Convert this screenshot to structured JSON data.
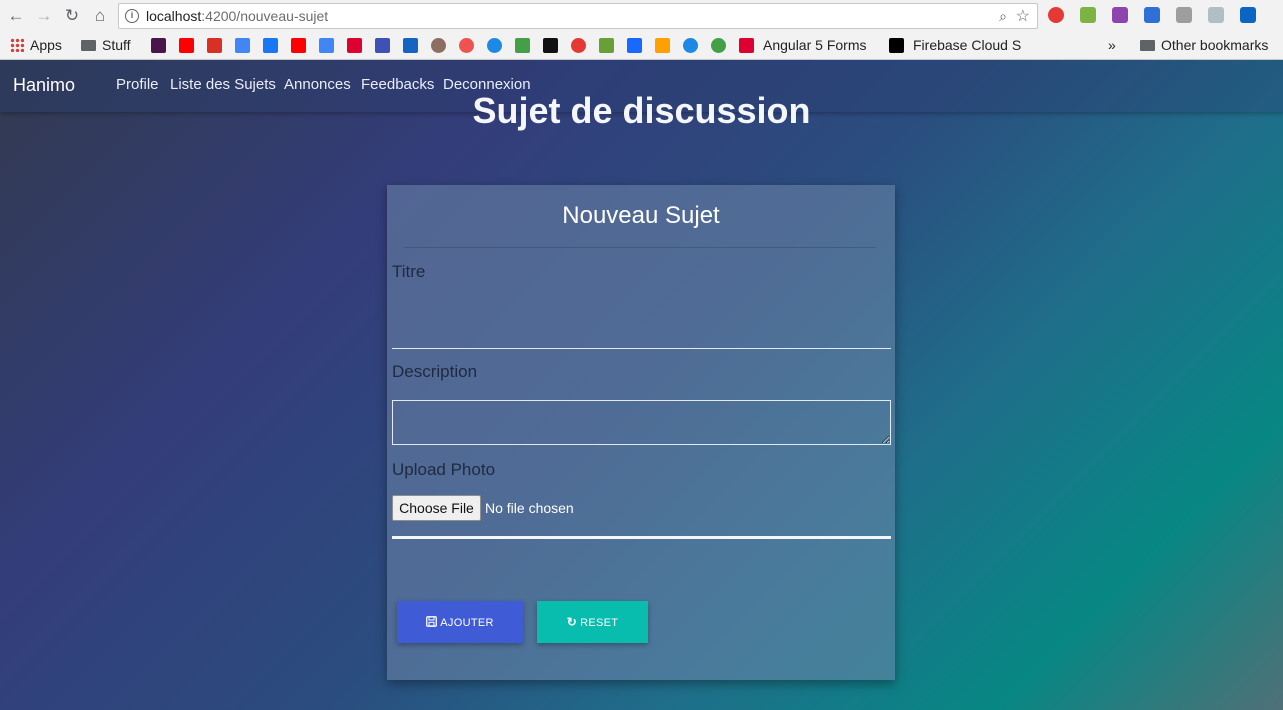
{
  "browser": {
    "url_host": "localhost",
    "url_path": ":4200/nouveau-sujet",
    "nav_icons": {
      "back": "arrow-left-icon",
      "forward": "arrow-right-icon",
      "reload": "reload-icon",
      "home": "home-icon"
    },
    "bookmarks": {
      "apps": "Apps",
      "stuff": "Stuff",
      "angular_forms": "Angular 5 Forms",
      "firebase_cloud": "Firebase Cloud S",
      "overflow": "»",
      "other_bookmarks": "Other bookmarks"
    }
  },
  "navbar": {
    "brand": "Hanimo",
    "links": [
      "Profile",
      "Liste des Sujets",
      "Annonces",
      "Feedbacks",
      "Deconnexion"
    ]
  },
  "page": {
    "title": "Sujet de discussion"
  },
  "form": {
    "card_title": "Nouveau Sujet",
    "titre_label": "Titre",
    "titre_value": "",
    "description_label": "Description",
    "description_value": "",
    "upload_label": "Upload Photo",
    "file_button": "Choose File",
    "file_status": "No file chosen",
    "submit_label": "AJOUTER",
    "reset_label": "RESET"
  },
  "colors": {
    "submit_button": "#3f5bd6",
    "reset_button": "#08bcae"
  }
}
